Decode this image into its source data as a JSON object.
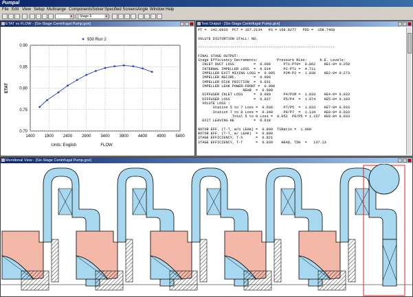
{
  "app": {
    "title": "Pumpal"
  },
  "menu": [
    "File",
    "Edit",
    "View",
    "Setup",
    "Multirange",
    "Components",
    "Solver",
    "Specified Screens",
    "Angle",
    "Window",
    "Help"
  ],
  "toolbar": {
    "stage_select": "Stage 6"
  },
  "chart_window": {
    "title": "ETAT vs FLOW - [Six-Stage Centrifugal Pump.gce]",
    "legend": "930 Run 2",
    "units_label": "Units: English"
  },
  "chart_data": {
    "type": "line",
    "title": "",
    "xlabel": "FLOW",
    "ylabel": "ETAT",
    "xlim": [
      1400,
      5400
    ],
    "ylim": [
      0.7,
      0.9
    ],
    "xticks": [
      "1400",
      "1900",
      "2400",
      "2900",
      "3400",
      "3900",
      "4400",
      "4900",
      "5400"
    ],
    "yticks": [
      "0.70",
      "0.75",
      "0.80",
      "0.85",
      "0.90"
    ],
    "grid": true,
    "legend_position": "top",
    "series": [
      {
        "name": "930 Run 2",
        "color": "#1f3fd0",
        "x": [
          1650,
          1850,
          2150,
          2400,
          2650,
          2900,
          3150,
          3400,
          3650,
          3900,
          4150,
          4400,
          4650
        ],
        "y": [
          0.756,
          0.772,
          0.79,
          0.806,
          0.819,
          0.831,
          0.84,
          0.847,
          0.851,
          0.853,
          0.851,
          0.846,
          0.838
        ]
      }
    ]
  },
  "text_window": {
    "title": "Text Output - [Six-Stage Centrifugal Pump.gce]",
    "lines": [
      "PT =  142.0833  PCT = 167.2134   PS = 156.8277   PDS =  158.7468",
      "",
      "VOLUTE DISTORTION STALL: NO.",
      "",
      "----------------------------------------------------------------",
      "",
      "FINAL STAGE OUTPUT:",
      "Stage Efficiency Decrements:         Pressure Rise:      K.E. Levels:",
      "  INLET DUCT LOSS         =  0.000      PT1-PT0=  0.862    KE1-0= 0.259",
      "  INTERNAL IMPELLER LOSS  =  0.014      P2-PT1 =  4.711",
      "  IMPELLER EXIT MIXING LOSS =  0.005    P2M-P2 =  1.038    KE2-0= 0.273",
      "  IMPELLER RECIRC.        =  0.000",
      "  IMPELLER DISK FRICTION  =  0.031",
      "  IMPELLER LEAK POWER-FRONT =  0.000",
      "                     REAR  =  0.000",
      "  DIFFUSER INLET LOSS     =  0.000      P4/P2M =  1.033    KE4-0= 0.033",
      "  DIFFUSER LOSS           =  0.037      P5/P4  =  1.074    KE5-0= 0.193",
      "  VOLUTE LOSS :",
      "       Station 5 to 7 Loss =  0.036     P7/P5  =  1.033    KE7-0= 0.033",
      "       Station 7 to 8 Loss =  0.348     P8/P7  =  1.134    KE8-0= 0.033",
      "                Total 5 to 8 Loss =  0.052  P8/P5 = 1.157  KE8-0= 0.033",
      "  EXIT LEAVING KE         =  0.018",
      "",
      "ROTOR EFF. (T-T, w/o LEAK) =  0.899  TSRatio =  1.000",
      "ROTOR EFF. (T-T, w/ LEAK)  =  0.899",
      "STAGE EFFICIENCY, T-S      =  0.821",
      "STAGE EFFICIENCY, T-T      =  0.839    HEAD, TDH  =   137.13"
    ]
  },
  "meridional_window": {
    "title": "Meridional View - [Six-Stage Centrifugal Pump.gce]",
    "colors": {
      "flow": "#a8d8f0",
      "impeller": "#f4b8a8",
      "outline": "#000000",
      "highlight": "#e02020"
    }
  }
}
